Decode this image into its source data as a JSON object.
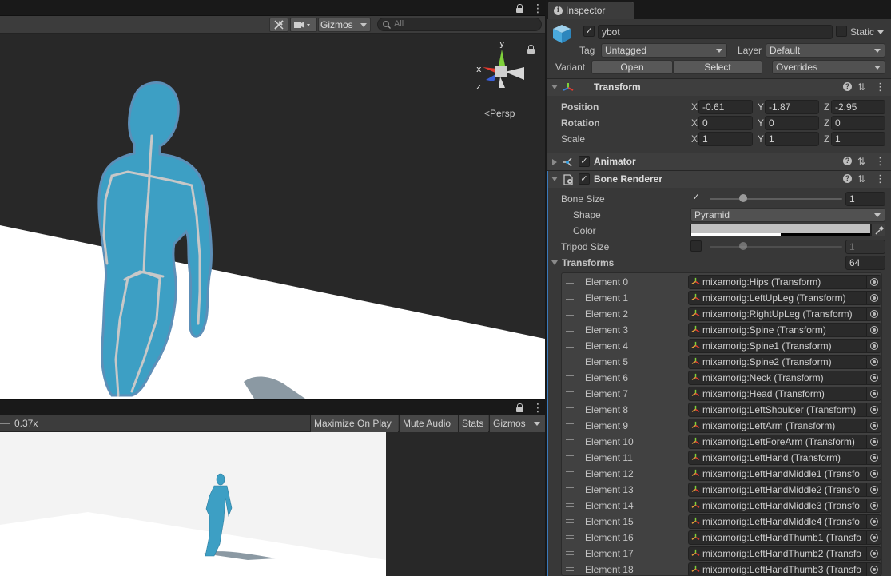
{
  "scene": {
    "toolbar": {
      "gizmos_label": "Gizmos",
      "search_placeholder": "All"
    },
    "persp_label": "Persp",
    "gizmo_axes": {
      "y": "y",
      "x": "x",
      "z": "z"
    }
  },
  "game": {
    "scale_value": "0.37x",
    "toolbar": {
      "maximize": "Maximize On Play",
      "mute": "Mute Audio",
      "stats": "Stats",
      "gizmos": "Gizmos"
    }
  },
  "inspector": {
    "tab_title": "Inspector",
    "object": {
      "name": "ybot",
      "static_label": "Static",
      "tag_label": "Tag",
      "tag_value": "Untagged",
      "layer_label": "Layer",
      "layer_value": "Default",
      "variant_label": "Variant",
      "open_label": "Open",
      "select_label": "Select",
      "overrides_label": "Overrides"
    },
    "transform": {
      "title": "Transform",
      "position_label": "Position",
      "rotation_label": "Rotation",
      "scale_label": "Scale",
      "axis_x": "X",
      "axis_y": "Y",
      "axis_z": "Z",
      "position": {
        "x": "-0.61",
        "y": "-1.87",
        "z": "-2.95"
      },
      "rotation": {
        "x": "0",
        "y": "0",
        "z": "0"
      },
      "scale": {
        "x": "1",
        "y": "1",
        "z": "1"
      }
    },
    "animator": {
      "title": "Animator"
    },
    "bone_renderer": {
      "title": "Bone Renderer",
      "bone_size_label": "Bone Size",
      "bone_size_value": "1",
      "bone_size_fraction": 0.25,
      "shape_label": "Shape",
      "shape_value": "Pyramid",
      "color_label": "Color",
      "color_value": "#bfbfbf",
      "tripod_size_label": "Tripod Size",
      "tripod_size_value": "1",
      "tripod_size_fraction": 0.25,
      "transforms_label": "Transforms",
      "transforms_count": "64",
      "elements": [
        {
          "label": "Element 0",
          "value": "mixamorig:Hips (Transform)"
        },
        {
          "label": "Element 1",
          "value": "mixamorig:LeftUpLeg (Transform)"
        },
        {
          "label": "Element 2",
          "value": "mixamorig:RightUpLeg (Transform)"
        },
        {
          "label": "Element 3",
          "value": "mixamorig:Spine (Transform)"
        },
        {
          "label": "Element 4",
          "value": "mixamorig:Spine1 (Transform)"
        },
        {
          "label": "Element 5",
          "value": "mixamorig:Spine2 (Transform)"
        },
        {
          "label": "Element 6",
          "value": "mixamorig:Neck (Transform)"
        },
        {
          "label": "Element 7",
          "value": "mixamorig:Head (Transform)"
        },
        {
          "label": "Element 8",
          "value": "mixamorig:LeftShoulder (Transform)"
        },
        {
          "label": "Element 9",
          "value": "mixamorig:LeftArm (Transform)"
        },
        {
          "label": "Element 10",
          "value": "mixamorig:LeftForeArm (Transform)"
        },
        {
          "label": "Element 11",
          "value": "mixamorig:LeftHand (Transform)"
        },
        {
          "label": "Element 12",
          "value": "mixamorig:LeftHandMiddle1 (Transfo"
        },
        {
          "label": "Element 13",
          "value": "mixamorig:LeftHandMiddle2 (Transfo"
        },
        {
          "label": "Element 14",
          "value": "mixamorig:LeftHandMiddle3 (Transfo"
        },
        {
          "label": "Element 15",
          "value": "mixamorig:LeftHandMiddle4 (Transfo"
        },
        {
          "label": "Element 16",
          "value": "mixamorig:LeftHandThumb1 (Transfo"
        },
        {
          "label": "Element 17",
          "value": "mixamorig:LeftHandThumb2 (Transfo"
        },
        {
          "label": "Element 18",
          "value": "mixamorig:LeftHandThumb3 (Transfo"
        }
      ]
    }
  },
  "icons": {
    "lock": "lock-icon",
    "menu": "kebab-menu-icon",
    "tools": "tools-icon",
    "camera": "camera-icon",
    "search": "search-icon",
    "info": "info-icon",
    "gameobject": "prefab-cube-icon",
    "transform": "transform-icon",
    "animator": "animator-icon",
    "bone_renderer": "script-icon",
    "help": "help-icon",
    "presets": "presets-icon",
    "eyedropper": "eyedropper-icon",
    "object_picker": "object-picker-icon"
  },
  "colors": {
    "character": "#3d9fc4",
    "accent_blue": "#3a79bb",
    "panel": "#383838"
  }
}
